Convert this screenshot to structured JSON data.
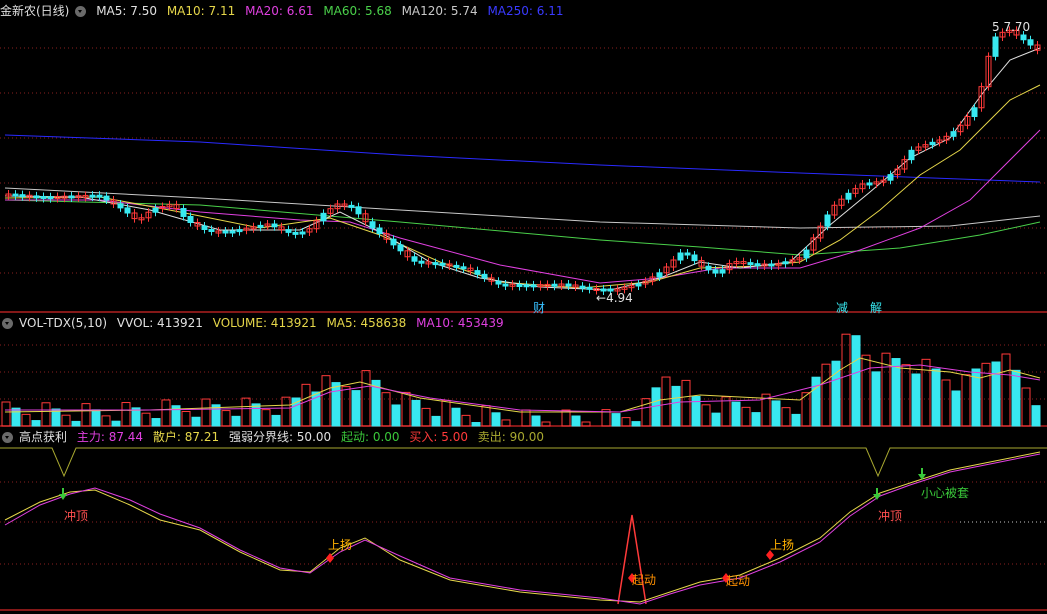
{
  "colors": {
    "ma5": "#e0e0e0",
    "ma10": "#e6d74a",
    "ma20": "#e040e0",
    "ma60": "#4ad04a",
    "ma120": "#c8c8c8",
    "ma250": "#2a2aff",
    "up": "#ff3a3a",
    "down": "#38e8f0",
    "grid": "#8a2020",
    "divider": "#b02020"
  },
  "kline": {
    "title": "金新农(日线)",
    "ma5_text": "MA5: 7.50",
    "ma10_text": "MA10: 7.11",
    "ma20_text": "MA20: 6.61",
    "ma60_text": "MA60: 5.68",
    "ma120_text": "MA120: 5.74",
    "ma250_text": "MA250: 6.11",
    "high_label": "7.70",
    "low_label": "4.94",
    "event_labels": [
      "财",
      "减",
      "解"
    ]
  },
  "volume": {
    "title": "VOL-TDX(5,10)",
    "vvol_text": "VVOL: 413921",
    "volume_text": "VOLUME: 413921",
    "ma5_text": "MA5: 458638",
    "ma10_text": "MA10: 453439"
  },
  "indicator": {
    "title": "高点获利",
    "zhuli_text": "主力: 87.44",
    "sanhu_text": "散户: 87.21",
    "qiangruo_text": "强弱分界线: 50.00",
    "qidong_text": "起动: 0.00",
    "mairu_text": "买入: 5.00",
    "maichu_text": "卖出: 90.00",
    "signals": [
      "冲顶",
      "上扬",
      "起动",
      "起动",
      "上扬",
      "冲顶",
      "小心被套"
    ]
  }
}
